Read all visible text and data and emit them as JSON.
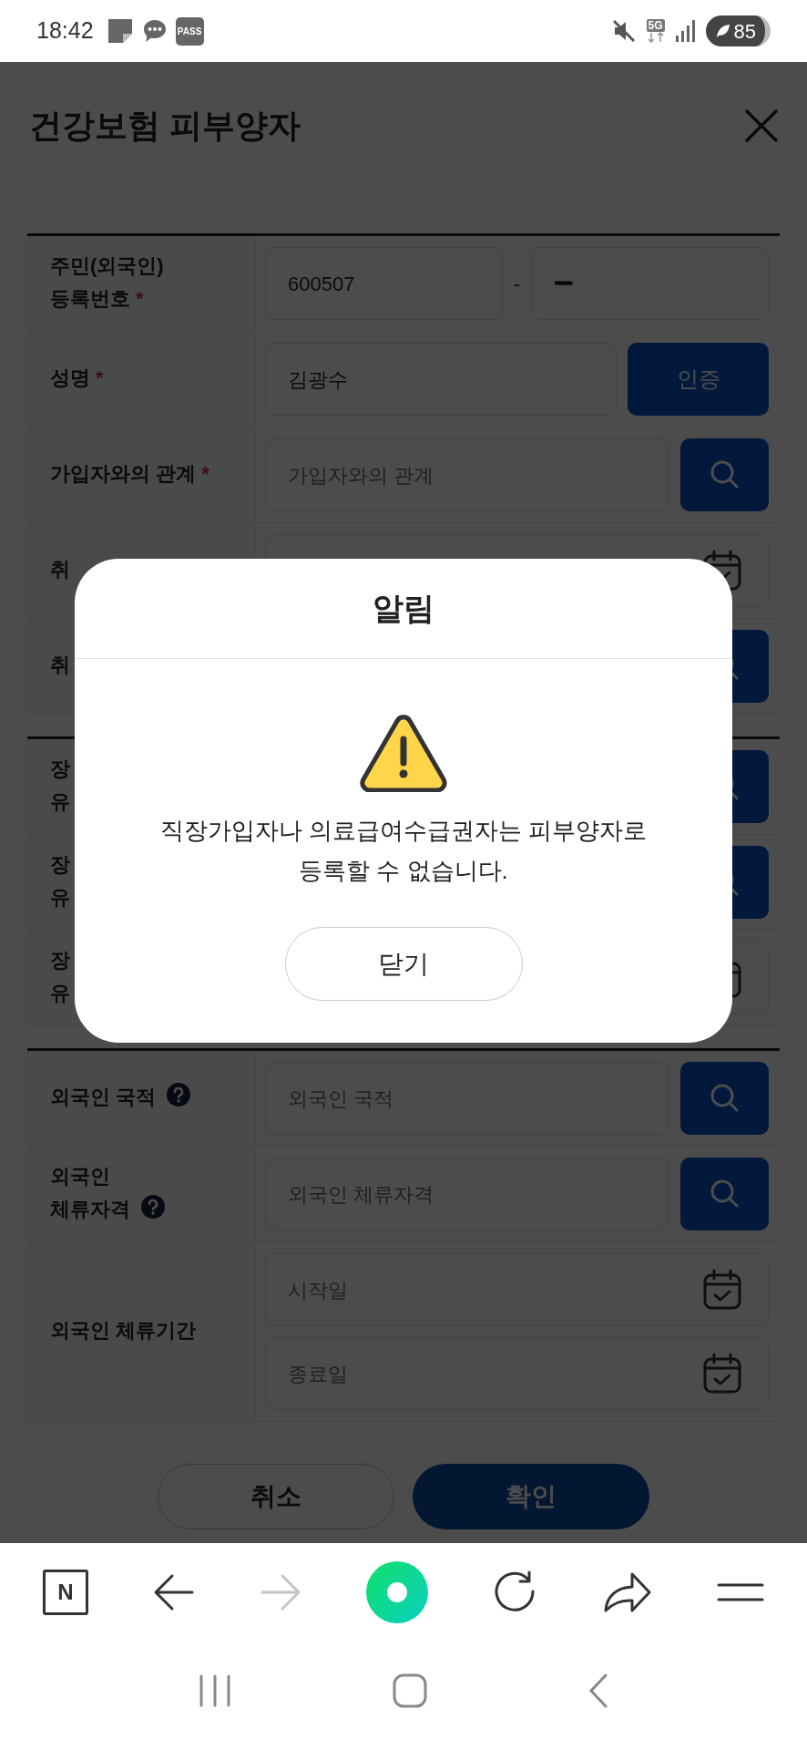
{
  "status_bar": {
    "time": "18:42",
    "app_badge": "PASS",
    "network": "5G",
    "battery": "85"
  },
  "header": {
    "title": "건강보험 피부양자"
  },
  "form": {
    "sections": [
      {
        "rows": [
          {
            "label": "주민(외국인)\n등록번호",
            "required_mark": "*",
            "kind": "id_number",
            "value": "600507",
            "separator": "-",
            "masked_value": "•••••••"
          },
          {
            "label": "성명",
            "required_mark": "*",
            "kind": "auth",
            "value": "김광수",
            "button": "인증"
          },
          {
            "label": "가입자와의 관계",
            "required_mark": "*",
            "kind": "search",
            "placeholder": "가입자와의 관계"
          },
          {
            "label": "취",
            "kind": "date"
          },
          {
            "label": "취",
            "kind": "search"
          }
        ]
      },
      {
        "rows": [
          {
            "label": "장\n유",
            "kind": "search"
          },
          {
            "label": "장\n유",
            "kind": "search"
          },
          {
            "label": "장\n유",
            "kind": "date"
          }
        ]
      },
      {
        "rows": [
          {
            "label": "외국인 국적",
            "help": true,
            "kind": "search",
            "placeholder": "외국인 국적"
          },
          {
            "label": "외국인\n체류자격",
            "help": true,
            "kind": "search",
            "placeholder": "외국인 체류자격"
          },
          {
            "label": "외국인 체류기간",
            "kind": "date_range",
            "placeholders": [
              "시작일",
              "종료일"
            ]
          }
        ]
      }
    ]
  },
  "actions": [
    {
      "label": "취소",
      "kind": "secondary"
    },
    {
      "label": "확인",
      "kind": "primary"
    }
  ],
  "dialog": {
    "title": "알림",
    "message": "직장가입자나 의료급여수급권자는 피부양자로\n등록할 수 없습니다.",
    "button": "닫기"
  },
  "browser_bar": {
    "logo": "N",
    "forward_disabled": true
  }
}
